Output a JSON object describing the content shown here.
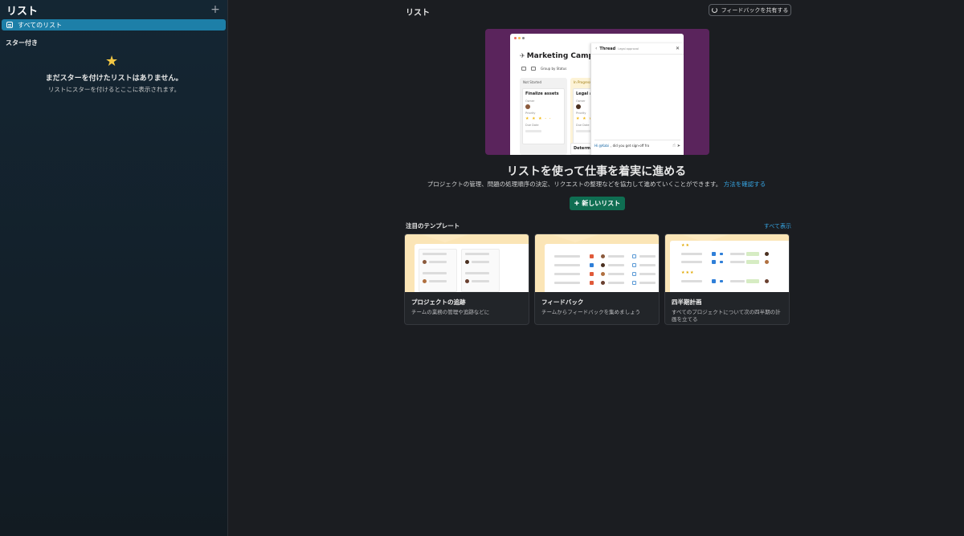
{
  "sidebar": {
    "title": "リスト",
    "add_icon": "plus-icon",
    "all_lists_label": "すべてのリスト",
    "starred_section": "スター付き",
    "empty_title": "まだスターを付けたリストはありません。",
    "empty_desc": "リストにスターを付けるとここに表示されます。",
    "accent_color": "#1d7fa8"
  },
  "header": {
    "title": "リスト",
    "feedback_label": "フィードバックを共有する"
  },
  "hero": {
    "mock": {
      "title": "Marketing Campaign",
      "group_by": "Group by Status",
      "col1_head": "Not Started",
      "col2_head": "In Progress",
      "card1_title": "Finalize assets",
      "card2_title": "Legal ap",
      "card3_title": "Determi",
      "owner_label": "Owner",
      "priority_label": "Priority",
      "due_label": "Due Date",
      "stars": "★ ★ ★ -  -",
      "thread_title": "Thread",
      "thread_sub": "Legal approval",
      "thread_mention": "Hi @Kabi",
      "thread_text": ", did you get sign-off fro"
    },
    "title": "リストを使って仕事を着実に進める",
    "desc": "プロジェクトの管理、問題の処理順序の決定、リクエストの整理などを協力して進めていくことができます。",
    "link": "方法を確認する",
    "new_list_label": "新しいリスト",
    "button_color": "#0f6e52"
  },
  "templates": {
    "title": "注目のテンプレート",
    "see_all": "すべて表示",
    "items": [
      {
        "title": "プロジェクトの追跡",
        "desc": "チームの業務の管理や追跡などに"
      },
      {
        "title": "フィードバック",
        "desc": "チームからフィードバックを集めましょう"
      },
      {
        "title": "四半期計画",
        "desc": "すべてのプロジェクトについて次の四半期の計画を立てる"
      }
    ]
  }
}
